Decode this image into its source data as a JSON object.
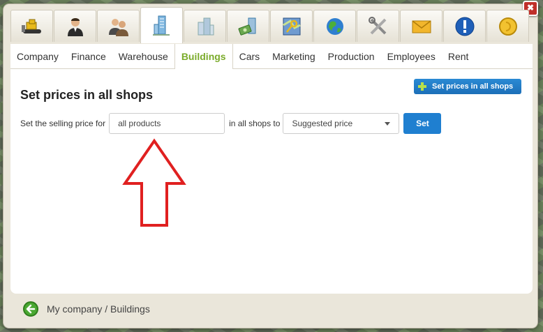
{
  "icon_tabs": [
    {
      "name": "bulldozer-icon"
    },
    {
      "name": "businessman-icon"
    },
    {
      "name": "people-icon"
    },
    {
      "name": "skyscraper-icon",
      "active": true
    },
    {
      "name": "buildings-icon"
    },
    {
      "name": "money-building-icon"
    },
    {
      "name": "map-key-icon"
    },
    {
      "name": "globe-icon"
    },
    {
      "name": "tools-icon"
    },
    {
      "name": "mail-icon"
    },
    {
      "name": "info-icon"
    },
    {
      "name": "coin-icon"
    }
  ],
  "tabs": [
    "Company",
    "Finance",
    "Warehouse",
    "Buildings",
    "Cars",
    "Marketing",
    "Production",
    "Employees",
    "Rent"
  ],
  "active_tab": "Buildings",
  "page": {
    "title": "Set prices in all shops",
    "action_button": "Set prices in all shops"
  },
  "form": {
    "label_before": "Set the selling price for",
    "product_value": "all products",
    "label_middle": "in all shops to",
    "price_option": "Suggested price",
    "submit_label": "Set"
  },
  "footer": {
    "breadcrumb": "My company / Buildings"
  },
  "colors": {
    "accent_blue": "#1f7fd0",
    "active_tab_green": "#7aab2a",
    "annotation_red": "#e02020"
  }
}
